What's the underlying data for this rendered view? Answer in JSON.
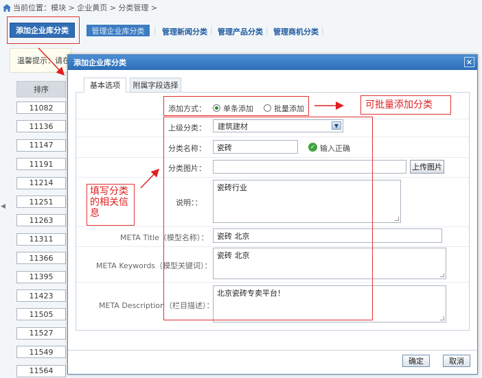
{
  "breadcrumb": {
    "text": "当前位置：模块 > 企业黄页 > 分类管理 >"
  },
  "tabs": {
    "active": "添加企业库分类",
    "manage_company": "管理企业库分类",
    "manage_news": "管理新闻分类",
    "manage_products": "管理产品分类",
    "manage_merchants": "管理商机分类",
    "separator": "|"
  },
  "tip": {
    "text": "温馨提示：请在"
  },
  "table": {
    "header": "排序",
    "rows": [
      "11082",
      "11136",
      "11147",
      "11191",
      "11214",
      "11251",
      "11263",
      "11311",
      "11366",
      "11395",
      "11423",
      "11505",
      "11527",
      "11549",
      "11564"
    ]
  },
  "modal": {
    "title": "添加企业库分类",
    "close": "×",
    "tabs": {
      "basic": "基本选项",
      "extra": "附属字段选择"
    },
    "add_mode": {
      "label": "添加方式：",
      "single": "单条添加",
      "batch": "批量添加"
    },
    "parent": {
      "label": "上级分类：",
      "value": "建筑建材"
    },
    "name": {
      "label": "分类名称：",
      "value": "瓷砖",
      "ok_text": "输入正确"
    },
    "image": {
      "label": "分类图片：",
      "value": "",
      "upload": "上传图片"
    },
    "desc": {
      "label": "说明：：",
      "value": "瓷砖行业"
    },
    "meta_title": {
      "label": "META Title（模型名称）：",
      "value": "瓷砖 北京"
    },
    "meta_keywords": {
      "label": "META Keywords（模型关键词）：",
      "value": "瓷砖 北京"
    },
    "meta_desc": {
      "label": "META Description（栏目描述）：",
      "value": "北京瓷砖专卖平台！"
    },
    "confirm": "确定",
    "cancel": "取消"
  },
  "annotations": {
    "batch_note": "可批量添加分类",
    "fill_note": "填写分类的相关信息"
  },
  "colors": {
    "accent": "#2f6eb6",
    "annotation": "#e02020"
  }
}
